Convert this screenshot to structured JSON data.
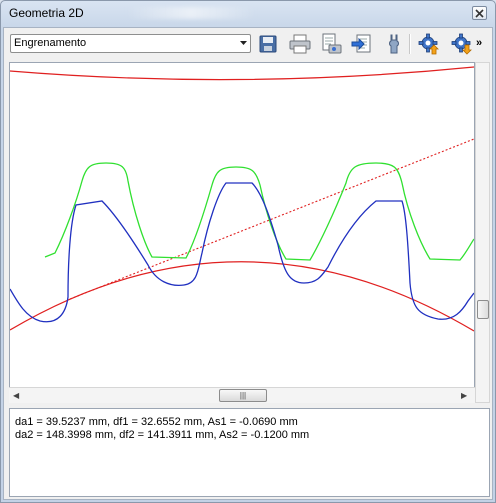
{
  "window": {
    "title": "Geometria 2D"
  },
  "toolbar": {
    "view_select": "Engrenamento",
    "buttons": [
      {
        "name": "save-icon"
      },
      {
        "name": "print-icon"
      },
      {
        "name": "print-preview-icon"
      },
      {
        "name": "export-icon"
      },
      {
        "name": "settings-icon"
      },
      {
        "name": "gear-up-icon"
      },
      {
        "name": "gear-down-icon"
      }
    ]
  },
  "colors": {
    "tip_circle": "#e02020",
    "gear1_profile": "#2030c0",
    "gear2_profile": "#30e030",
    "line_of_action": "#e02020"
  },
  "results": {
    "line1": "da1 = 39.5237 mm, df1 = 32.6552 mm, As1 = -0.0690 mm",
    "line2": "da2 = 148.3998 mm, df2 = 141.3911 mm, As2 = -0.1200 mm"
  }
}
